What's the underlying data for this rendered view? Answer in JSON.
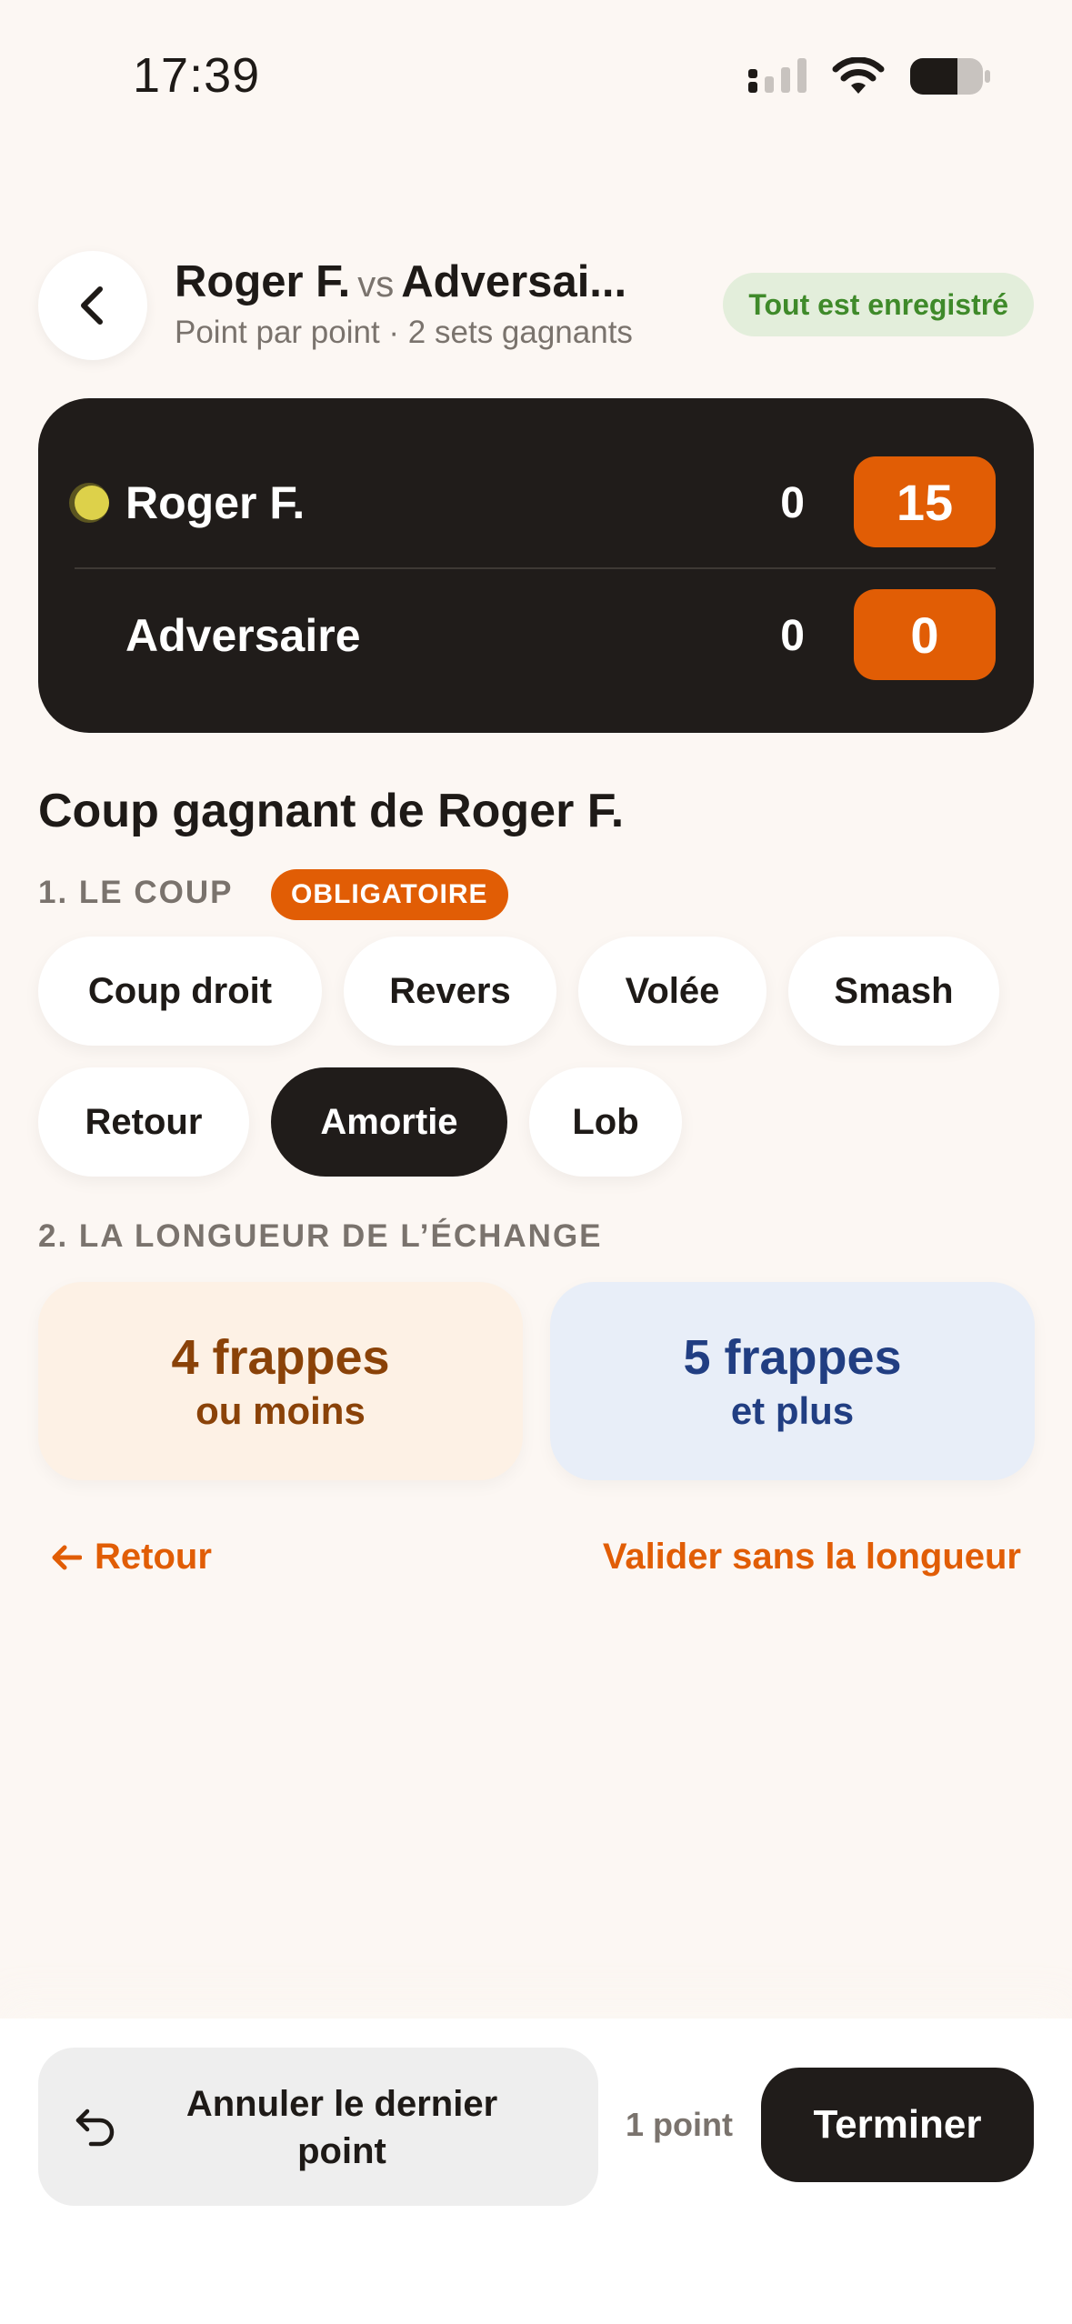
{
  "status_bar": {
    "time": "17:39"
  },
  "header": {
    "player1": "Roger F.",
    "vs": "vs",
    "player2": "Adversai...",
    "subtitle": "Point par point · 2 sets gagnants",
    "saved_badge": "Tout est enregistré"
  },
  "scoreboard": {
    "rows": [
      {
        "name": "Roger F.",
        "games": "0",
        "points": "15",
        "serving": true
      },
      {
        "name": "Adversaire",
        "games": "0",
        "points": "0",
        "serving": false
      }
    ]
  },
  "section_title": "Coup gagnant de Roger F.",
  "step1": {
    "label": "1. LE COUP",
    "badge": "OBLIGATOIRE",
    "shots": [
      "Coup droit",
      "Revers",
      "Volée",
      "Smash",
      "Retour",
      "Amortie",
      "Lob"
    ],
    "selected": "Amortie"
  },
  "step2": {
    "label": "2. LA LONGUEUR DE L’ÉCHANGE",
    "short": {
      "big": "4 frappes",
      "small": "ou moins"
    },
    "long": {
      "big": "5 frappes",
      "small": "et plus"
    }
  },
  "links": {
    "back": "Retour",
    "skip": "Valider sans la longueur"
  },
  "bottom": {
    "undo": "Annuler le dernier point",
    "point_count": "1 point",
    "finish": "Terminer"
  },
  "colors": {
    "accent": "#e15d05",
    "dark": "#201c1a",
    "background": "#fcf7f3",
    "saved_green": "#3f8a2a"
  }
}
